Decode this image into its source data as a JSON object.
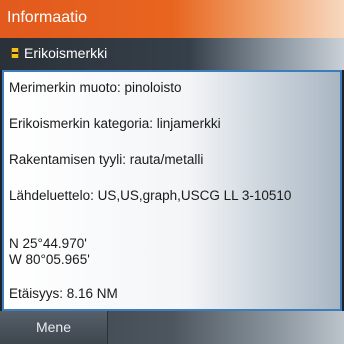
{
  "window": {
    "title": "Informaatio"
  },
  "item": {
    "icon": "special-mark-buoy-icon",
    "label": "Erikoismerkki"
  },
  "details": {
    "shape": "Merimerkin muoto: pinoloisto",
    "category": "Erikoismerkin kategoria: linjamerkki",
    "construction": "Rakentamisen tyyli: rauta/metalli",
    "source": "Lähdeluettelo: US,US,graph,USCG LL 3-10510",
    "latitude": "N  25°44.970'",
    "longitude": "W  80°05.965'",
    "distance": "Etäisyys: 8.16 NM"
  },
  "footer": {
    "go_label": "Mene"
  },
  "colors": {
    "title_accent": "#e25a1e",
    "border_accent": "#3e7dbd"
  }
}
